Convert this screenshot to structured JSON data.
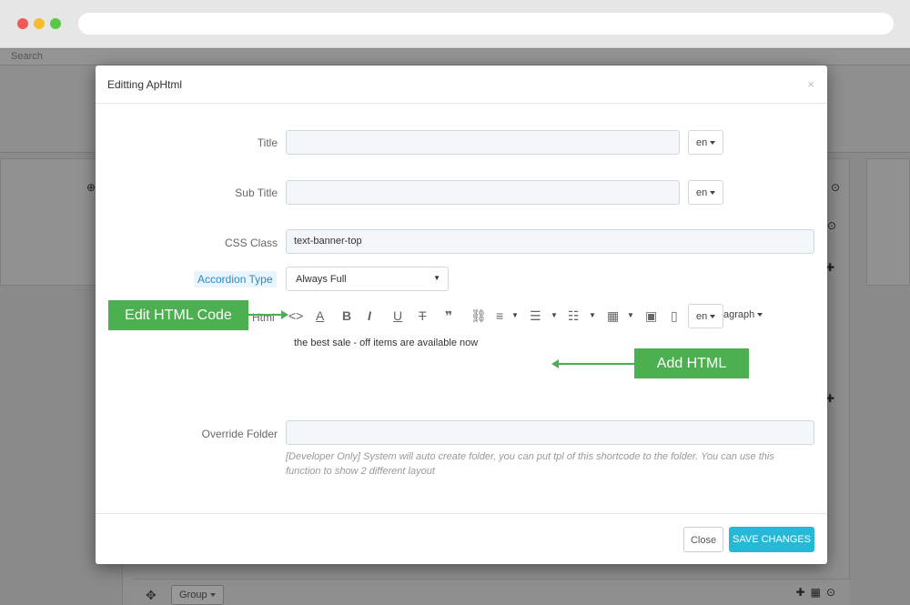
{
  "browser": {
    "url": ""
  },
  "background": {
    "search_label": "Search",
    "group_label": "Group",
    "icons": [
      "plus-circle-icon",
      "move-icon",
      "plus-icon",
      "grid-icon",
      "arrow-down-circle-icon"
    ]
  },
  "modal": {
    "title": "Editting ApHtml",
    "close_symbol": "×",
    "fields": {
      "title": {
        "label": "Title",
        "value": "",
        "lang": "en"
      },
      "sub_title": {
        "label": "Sub Title",
        "value": "",
        "lang": "en"
      },
      "css_class": {
        "label": "CSS Class",
        "value": "text-banner-top"
      },
      "accordion_type": {
        "label": "Accordion Type",
        "selected": "Always Full"
      },
      "html": {
        "label": "Html",
        "lang": "en",
        "paragraph_label": "agraph",
        "content": "the best sale - off items are available now"
      },
      "override_folder": {
        "label": "Override Folder",
        "value": "",
        "help": "[Developer Only] System will auto create folder, you can put tpl of this shortcode to the folder. You can use this function to show 2 different layout"
      }
    },
    "toolbar_icons": [
      "code-icon",
      "font-color-icon",
      "bold-icon",
      "italic-icon",
      "underline-icon",
      "strikethrough-icon",
      "quote-icon",
      "link-icon",
      "align-icon",
      "bullet-list-icon",
      "numbered-list-icon",
      "table-icon",
      "image-icon"
    ],
    "footer": {
      "close_label": "Close",
      "save_label": "SAVE CHANGES"
    }
  },
  "callouts": {
    "edit_html": "Edit HTML Code",
    "add_html": "Add HTML"
  },
  "colors": {
    "accent": "#25b9d7",
    "callout": "#4caf50",
    "label_highlight": "#2d8ac7"
  }
}
